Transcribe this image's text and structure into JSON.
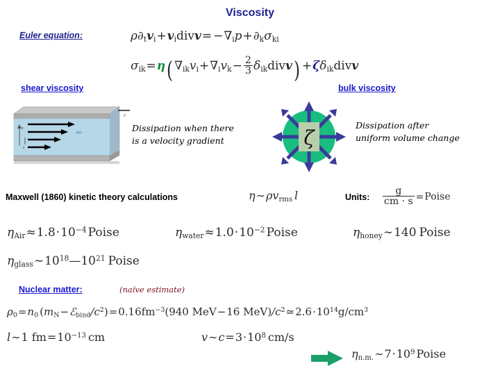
{
  "slide": {
    "title": "Viscosity"
  },
  "euler": {
    "label": "Euler equation:",
    "equation_text": "ρ∂ₜ𝒗ᵢ + 𝒗ᵢdiv𝒗 = −∇ᵢp + ∂ₖσₖᵢ",
    "rho": "ρ",
    "partial_t": "∂",
    "v": "v",
    "div": "div",
    "equals": "=",
    "minus": "−",
    "plus": "+",
    "nabla": "∇",
    "p": "p",
    "sigma": "σ",
    "sub_t": "t",
    "sub_i": "i",
    "sub_k": "k",
    "sub_ki": "ki"
  },
  "sigma_eq": {
    "equation_text": "σᵢₖ = η(∇ₖvᵢ + ∇ᵢvₖ − (2/3)δᵢₖdiv𝒗) + ζδᵢₖdiv𝒗",
    "sigma": "σ",
    "sub_ik": "ik",
    "equals": "=",
    "eta": "η",
    "zeta": "ζ",
    "nabla": "∇",
    "v": "v",
    "delta": "δ",
    "div": "div",
    "bold_v": "v",
    "plus": "+",
    "minus": "−",
    "frac_num": "2",
    "frac_den": "3",
    "paren_open": "(",
    "paren_close": ")",
    "eta_color": "#108a3c",
    "zeta_color": "#1a1a8c"
  },
  "shear": {
    "link_label": "shear viscosity",
    "caption_line1": "Dissipation when there",
    "caption_line2": "is a velocity gradient",
    "axis_y": "y",
    "axis_x": "x",
    "velocity_label": "v(y)",
    "force_label": "F",
    "fluid_color": "#b6d7e8",
    "slab_color": "#b8b8b8"
  },
  "bulk": {
    "link_label": "bulk viscosity",
    "caption_line1": "Dissipation after",
    "caption_line2": "uniform volume change",
    "center_symbol": "ζ",
    "circle_color": "#19bd7e",
    "arrow_color": "#3a3a9c",
    "square_color": "#b9ceaa"
  },
  "maxwell": {
    "text": "Maxwell (1860) kinetic theory calculations",
    "eta": "η",
    "tilde": "∼",
    "rho": "ρ",
    "v": "v",
    "sub_rms": "rms",
    "l": "l",
    "units_label": "Units:",
    "units_num": "g",
    "units_den": "cm · s",
    "units_equals": "=",
    "units_value": "Poise"
  },
  "values": [
    {
      "name": "air",
      "eta": "η",
      "sub": "Air",
      "rel": "≈",
      "mantissa": "1.8",
      "dot": "·",
      "base": "10",
      "exponent": "−4",
      "unit": "Poise"
    },
    {
      "name": "water",
      "eta": "η",
      "sub": "water",
      "rel": "≈",
      "mantissa": "1.0",
      "dot": "·",
      "base": "10",
      "exponent": "−2",
      "unit": "Poise"
    },
    {
      "name": "honey",
      "eta": "η",
      "sub": "honey",
      "rel": "∼",
      "mantissa": "140",
      "dot": "",
      "base": "",
      "exponent": "",
      "unit": "Poise"
    }
  ],
  "glass": {
    "eta": "η",
    "sub": "glass",
    "rel": "∼",
    "base1": "10",
    "exp1": "18",
    "dash": "—",
    "base2": "10",
    "exp2": "21",
    "unit": "Poise"
  },
  "nuclear": {
    "label": "Nuclear matter:",
    "note": "(naïve estimate)",
    "rho_eq": {
      "rho": "ρ",
      "sub0": "0",
      "equals1": "=",
      "n": "n",
      "paren_open": "(",
      "m": "m",
      "sub_N": "N",
      "minus": "−",
      "E": "ℰ",
      "sub_bind": "bind",
      "over_c2": "/c",
      "exp2": "2",
      "paren_close": ")",
      "equals2": "=",
      "density": "0.16",
      "fm_unit": "fm",
      "fm_exp": "−3",
      "mass1": "(940 MeV",
      "mass2": "16 MeV)",
      "per_c2": "/c",
      "rel": "≃",
      "result_mantissa": "2.6",
      "dot": "·",
      "result_base": "10",
      "result_exp": "14",
      "result_unit": "g/cm",
      "result_unit_exp": "3"
    },
    "length_eq": {
      "l": "l",
      "tilde": "∼",
      "value": "1 fm",
      "equals": "=",
      "base": "10",
      "exponent": "−13",
      "unit": "cm"
    },
    "velocity_eq": {
      "v": "v",
      "tilde": "∼",
      "c": "c",
      "equals": "=",
      "mantissa": "3",
      "dot": "·",
      "base": "10",
      "exponent": "8",
      "unit": "cm/s"
    },
    "result_eq": {
      "eta": "η",
      "sub": "n.m.",
      "tilde": "∼",
      "mantissa": "7",
      "dot": "·",
      "base": "10",
      "exponent": "9",
      "unit": "Poise"
    },
    "arrow_color": "#19a06a"
  }
}
